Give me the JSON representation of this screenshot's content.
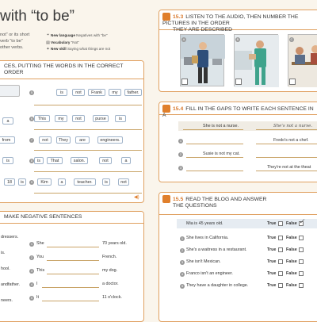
{
  "page": {
    "title": "with “to be”",
    "intro": [
      "not” or its short",
      "verb “to be”",
      "other verbs."
    ],
    "meta": [
      {
        "label": "New language",
        "value": "Negatives with “be”"
      },
      {
        "label": "Vocabulary",
        "value": "“Not”"
      },
      {
        "label": "New skill",
        "value": "Saying what things are not"
      }
    ]
  },
  "ex1": {
    "title": "CES, PUTTING THE WORDS IN THE CORRECT ORDER",
    "col2": [
      {
        "num": "5",
        "words": [
          "is",
          "not",
          "Frank",
          "my",
          "father."
        ]
      },
      {
        "num": "6",
        "words": [
          "This",
          "my",
          "not",
          "purse",
          "is"
        ]
      },
      {
        "num": "7",
        "words": [
          "not",
          "They",
          "are",
          "engineers."
        ]
      },
      {
        "num": "8",
        "words": [
          "is",
          "That",
          "salon.",
          "not",
          "a"
        ]
      },
      {
        "num": "9",
        "words": [
          "Kim",
          "a",
          "teacher.",
          "is",
          "not"
        ]
      }
    ],
    "col1": [
      "a",
      "from",
      "is",
      "18",
      "is"
    ]
  },
  "ex2": {
    "title": "MAKE NEGATIVE SENTENCES",
    "left": [
      "dressers.",
      "is.",
      "hool.",
      "andfather.",
      "neers."
    ],
    "right": [
      {
        "num": "1",
        "pre": "She",
        "post": "70 years old."
      },
      {
        "num": "2",
        "pre": "You",
        "post": "French."
      },
      {
        "num": "3",
        "pre": "This",
        "post": "my dog."
      },
      {
        "num": "4",
        "pre": "I",
        "post": "a doctor."
      },
      {
        "num": "5",
        "pre": "It",
        "post": "11 o'clock."
      }
    ]
  },
  "ex3": {
    "num": "15.3",
    "title": "LISTEN TO THE AUDIO, THEN NUMBER THE PICTURES IN THE ORDER",
    "title2": "THEY ARE DESCRIBED",
    "labels": [
      "A",
      "B",
      "C"
    ]
  },
  "ex4": {
    "num": "15.4",
    "title": "FILL IN THE GAPS TO WRITE EACH SENTENCE IN A",
    "rows": [
      {
        "left": "She is not a nurse.",
        "right": "She's not a nurse."
      },
      {
        "left": "",
        "right": "Fredo's not a chef."
      },
      {
        "left": "Susie is not my cat.",
        "right": ""
      },
      {
        "left": "",
        "right": "They're not at the theat"
      }
    ]
  },
  "ex5": {
    "num": "15.5",
    "title": "READ THE BLOG AND ANSWER",
    "title2": "THE QUESTIONS",
    "true_label": "True",
    "false_label": "False",
    "check": "✓",
    "rows": [
      "Mia is 45 years old.",
      "She lives in California.",
      "She's a waitress in a restaurant.",
      "She isn't Mexican.",
      "Franco isn't an engineer.",
      "They have a daughter in college."
    ]
  },
  "colors": {
    "accent": "#e07f2c",
    "border": "#e0a060",
    "paper": "#faf5ec"
  }
}
